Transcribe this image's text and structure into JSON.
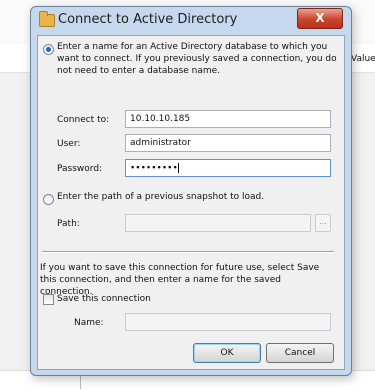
{
  "background": {
    "column_header": "Value"
  },
  "dialog": {
    "title": "Connect to Active Directory",
    "close_glyph": "X",
    "option_database": {
      "text": "Enter a name for an Active Directory database to which you want to connect. If you previously saved a connection, you do not need to enter a database name.",
      "selected": true
    },
    "fields": {
      "connect_to": {
        "label": "Connect to:",
        "value": "10.10.10.185"
      },
      "user": {
        "label": "User:",
        "value": "administrator"
      },
      "password": {
        "label": "Password:",
        "value": "•••••••••"
      }
    },
    "option_snapshot": {
      "text": "Enter the path of a previous snapshot to load.",
      "selected": false
    },
    "path": {
      "label": "Path:",
      "value": "",
      "browse_label": "..."
    },
    "save_note": "If you want to save this connection for future use, select Save this connection, and then enter a name for the saved connection.",
    "save_checkbox": {
      "label": "Save this connection",
      "checked": false
    },
    "name": {
      "label": "Name:",
      "value": ""
    },
    "buttons": {
      "ok": "OK",
      "cancel": "Cancel"
    }
  }
}
